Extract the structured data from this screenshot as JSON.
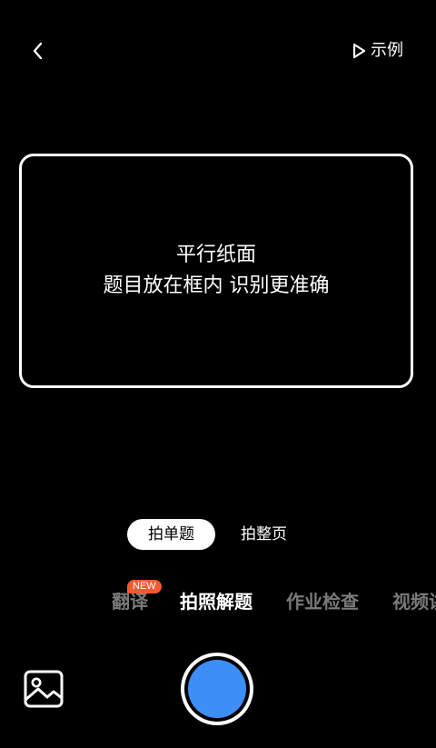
{
  "header": {
    "back_icon": "chevron-left-icon",
    "example_icon": "play-outline-icon",
    "example_label": "示例"
  },
  "frame": {
    "hint_line1": "平行纸面",
    "hint_line2": "题目放在框内 识别更准确"
  },
  "mode_switch": {
    "options": [
      {
        "label": "拍单题",
        "selected": true
      },
      {
        "label": "拍整页",
        "selected": false
      }
    ]
  },
  "feature_tabs": {
    "items": [
      {
        "label": "翻译",
        "badge": "NEW",
        "active": false
      },
      {
        "label": "拍照解题",
        "active": true
      },
      {
        "label": "作业检查",
        "active": false
      },
      {
        "label": "视频讲解",
        "active": false
      }
    ]
  },
  "bottom": {
    "gallery_icon": "image-icon",
    "shutter_icon": "shutter-icon"
  },
  "colors": {
    "background": "#000000",
    "accent_blue": "#3d8ef7",
    "badge_orange": "#f25b32",
    "inactive_tab": "#7a7a7a"
  }
}
